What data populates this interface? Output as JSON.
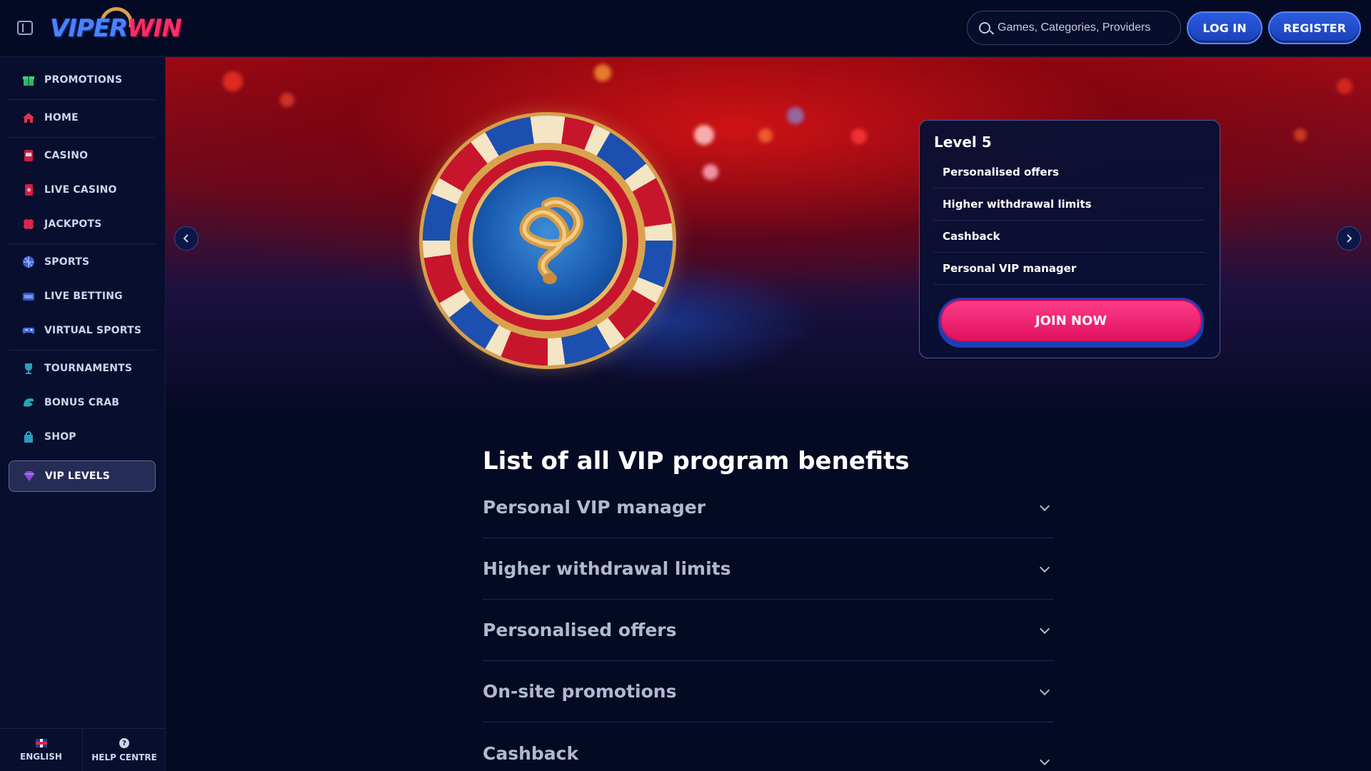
{
  "header": {
    "logo_text_viper": "VIPER",
    "logo_text_win": "WIN",
    "search_placeholder": "Games, Categories, Providers",
    "login_label": "LOG IN",
    "register_label": "REGISTER"
  },
  "sidebar": {
    "items": [
      {
        "label": "PROMOTIONS",
        "icon": "gift-icon"
      },
      {
        "label": "HOME",
        "icon": "home-icon"
      },
      {
        "label": "CASINO",
        "icon": "slot-machine-icon"
      },
      {
        "label": "LIVE CASINO",
        "icon": "cards-icon"
      },
      {
        "label": "JACKPOTS",
        "icon": "clover-icon"
      },
      {
        "label": "SPORTS",
        "icon": "ball-icon"
      },
      {
        "label": "LIVE BETTING",
        "icon": "live-icon"
      },
      {
        "label": "VIRTUAL SPORTS",
        "icon": "gamepad-icon"
      },
      {
        "label": "TOURNAMENTS",
        "icon": "trophy-icon"
      },
      {
        "label": "BONUS CRAB",
        "icon": "crab-claw-icon"
      },
      {
        "label": "SHOP",
        "icon": "bag-icon"
      },
      {
        "label": "VIP LEVELS",
        "icon": "diamond-icon"
      }
    ],
    "footer": {
      "language_label": "ENGLISH",
      "help_label": "HELP CENTRE"
    }
  },
  "hero": {
    "level_title": "Level 5",
    "benefits": [
      "Personalised offers",
      "Higher withdrawal limits",
      "Cashback",
      "Personal VIP manager"
    ],
    "join_label": "JOIN NOW",
    "colors": {
      "accent_pink": "#ff2d73",
      "accent_blue": "#2a5be0"
    }
  },
  "main": {
    "title": "List of all VIP program benefits",
    "accordion": [
      "Personal VIP manager",
      "Higher withdrawal limits",
      "Personalised offers",
      "On-site promotions",
      "Cashback"
    ]
  }
}
